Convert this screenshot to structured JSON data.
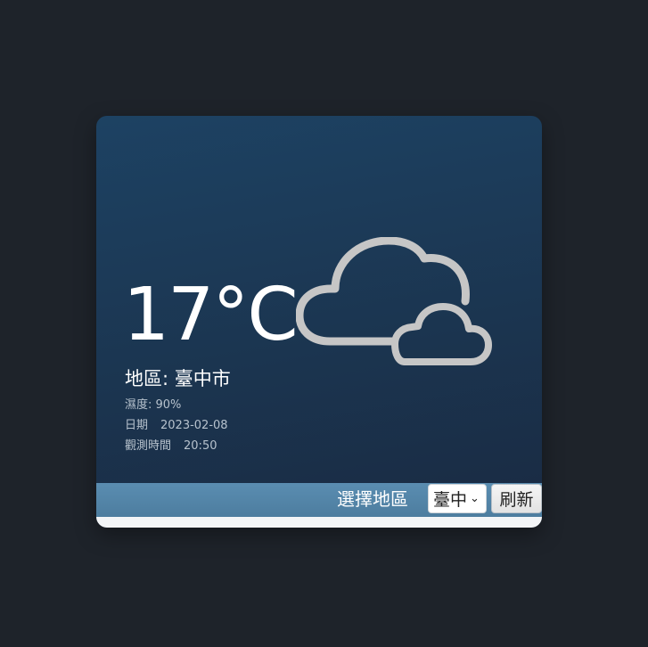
{
  "weather": {
    "temperature": "17°C",
    "icon": "cloudy-icon",
    "region_label": "地區: 臺中市",
    "humidity": "濕度: 90%",
    "date_label": "日期",
    "date_value": "2023-02-08",
    "time_label": "觀測時間",
    "time_value": "20:50"
  },
  "controls": {
    "select_label": "選擇地區",
    "selected_region": "臺中",
    "refresh_label": "刷新"
  },
  "colors": {
    "page_background": "#1e232a",
    "card_top": "#1d4263",
    "card_bottom": "#1a2a42",
    "bar": "#5a8db1",
    "icon_stroke": "#c8c8c8"
  }
}
